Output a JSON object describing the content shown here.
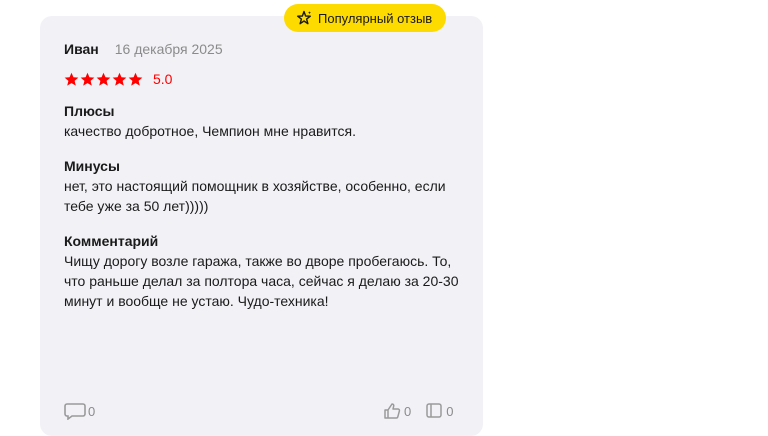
{
  "badge": {
    "label": "Популярный отзыв",
    "icon": "sparkle-star-icon",
    "color": "#fddb00"
  },
  "review": {
    "author": "Иван",
    "date": "16 декабря 2025",
    "rating": 5,
    "rating_label": "5.0",
    "rating_color": "#ff0000",
    "pros": {
      "heading": "Плюсы",
      "text": "качество добротное, Чемпион мне нравится."
    },
    "cons": {
      "heading": "Минусы",
      "line1": "нет, это настоящий помощник в хозяйстве, особенно, если",
      "line2": "тебе уже за 50 лет)))))"
    },
    "comment": {
      "heading": "Комментарий",
      "line1": "Чищу дорогу возле гаража, также во дворе пробегаюсь. То,",
      "line2": "что раньше делал за полтора часа, сейчас я делаю за 20-30",
      "line3": "минут и вообще не устаю. Чудо-техника!"
    }
  },
  "footer": {
    "comments_count": "0",
    "likes_count": "0",
    "dislikes_count": "0"
  }
}
